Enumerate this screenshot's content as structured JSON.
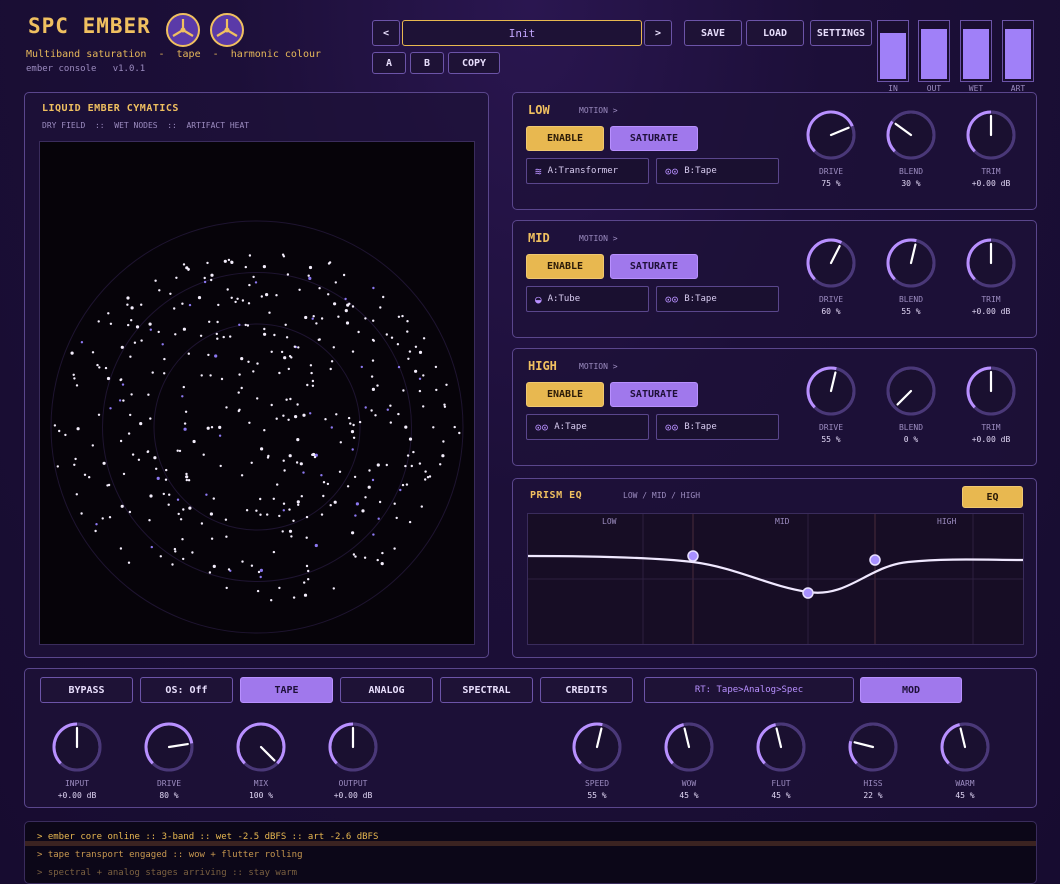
{
  "header": {
    "title": "SPC EMBER",
    "subtitle": "Multiband saturation  -  tape  -  harmonic colour",
    "version": "ember console   v1.0.1",
    "reel_icon": "tape-reel-icon"
  },
  "preset": {
    "prev": "<",
    "name": "Init",
    "next": ">",
    "save": "SAVE",
    "load": "LOAD",
    "settings": "SETTINGS",
    "a": "A",
    "b": "B",
    "copy": "COPY"
  },
  "meters": [
    {
      "label": "IN",
      "level": 0.8
    },
    {
      "label": "OUT",
      "level": 0.86
    },
    {
      "label": "WET",
      "level": 0.86
    },
    {
      "label": "ART",
      "level": 0.86
    }
  ],
  "cymatics": {
    "title": "LIQUID EMBER CYMATICS",
    "subtitle": "DRY FIELD  ::  WET NODES  ::  ARTIFACT HEAT"
  },
  "bands": [
    {
      "name": "LOW",
      "motion": "MOTION >",
      "enable": "ENABLE",
      "saturate": "SATURATE",
      "slot_a": "A:Transformer",
      "slot_a_icon": "transformer-icon",
      "slot_b": "B:Tape",
      "slot_b_icon": "tape-icon",
      "knobs": [
        {
          "label": "DRIVE",
          "value": "75 %",
          "amount": 0.75
        },
        {
          "label": "BLEND",
          "value": "30 %",
          "amount": 0.3
        },
        {
          "label": "TRIM",
          "value": "+0.00 dB",
          "amount": 0.5
        }
      ]
    },
    {
      "name": "MID",
      "motion": "MOTION >",
      "enable": "ENABLE",
      "saturate": "SATURATE",
      "slot_a": "A:Tube",
      "slot_a_icon": "tube-icon",
      "slot_b": "B:Tape",
      "slot_b_icon": "tape-icon",
      "knobs": [
        {
          "label": "DRIVE",
          "value": "60 %",
          "amount": 0.6
        },
        {
          "label": "BLEND",
          "value": "55 %",
          "amount": 0.55
        },
        {
          "label": "TRIM",
          "value": "+0.00 dB",
          "amount": 0.5
        }
      ]
    },
    {
      "name": "HIGH",
      "motion": "MOTION >",
      "enable": "ENABLE",
      "saturate": "SATURATE",
      "slot_a": "A:Tape",
      "slot_a_icon": "tape-icon",
      "slot_b": "B:Tape",
      "slot_b_icon": "tape-icon",
      "knobs": [
        {
          "label": "DRIVE",
          "value": "55 %",
          "amount": 0.55
        },
        {
          "label": "BLEND",
          "value": "0 %",
          "amount": 0.0
        },
        {
          "label": "TRIM",
          "value": "+0.00 dB",
          "amount": 0.5
        }
      ]
    }
  ],
  "eq": {
    "title": "PRISM EQ",
    "subtitle": "LOW / MID / HIGH",
    "button": "EQ",
    "bands": [
      "LOW",
      "MID",
      "HIGH"
    ]
  },
  "footer": {
    "buttons": {
      "bypass": "BYPASS",
      "os": "OS: Off",
      "tape": "TAPE",
      "analog": "ANALOG",
      "spectral": "SPECTRAL",
      "credits": "CREDITS",
      "route": "RT: Tape>Analog>Spec",
      "mod": "MOD"
    },
    "knobs_left": [
      {
        "label": "INPUT",
        "value": "+0.00 dB",
        "amount": 0.5
      },
      {
        "label": "DRIVE",
        "value": "80 %",
        "amount": 0.8
      },
      {
        "label": "MIX",
        "value": "100 %",
        "amount": 1.0
      },
      {
        "label": "OUTPUT",
        "value": "+0.00 dB",
        "amount": 0.5
      }
    ],
    "knobs_right": [
      {
        "label": "SPEED",
        "value": "55 %",
        "amount": 0.55
      },
      {
        "label": "WOW",
        "value": "45 %",
        "amount": 0.45
      },
      {
        "label": "FLUT",
        "value": "45 %",
        "amount": 0.45
      },
      {
        "label": "HISS",
        "value": "22 %",
        "amount": 0.22
      },
      {
        "label": "WARM",
        "value": "45 %",
        "amount": 0.45
      }
    ]
  },
  "log": [
    "> ember core online :: 3-band :: wet -2.5 dBFS :: art -2.6 dBFS",
    "> tape transport engaged :: wow + flutter rolling",
    "> spectral + analog stages arriving :: stay warm"
  ],
  "colors": {
    "gold": "#e8b850",
    "purple": "#a078ec",
    "panel_border": "#5a468c"
  }
}
